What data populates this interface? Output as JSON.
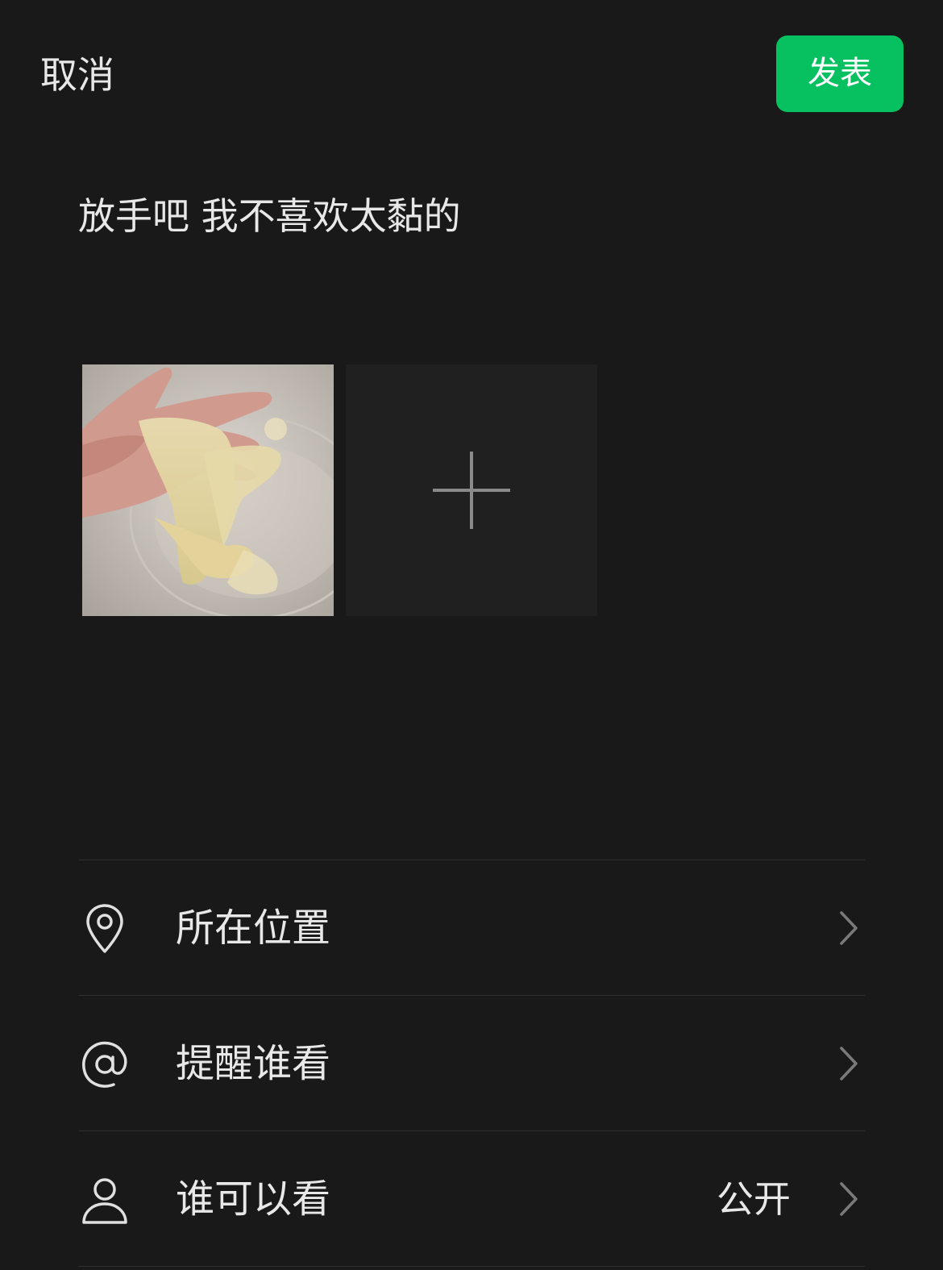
{
  "header": {
    "cancel_label": "取消",
    "publish_label": "发表"
  },
  "post": {
    "text": "放手吧 我不喜欢太黏的"
  },
  "media": {
    "add_icon": "plus-icon"
  },
  "options": [
    {
      "icon": "location-pin-icon",
      "label": "所在位置",
      "value": ""
    },
    {
      "icon": "at-sign-icon",
      "label": "提醒谁看",
      "value": ""
    },
    {
      "icon": "person-icon",
      "label": "谁可以看",
      "value": "公开"
    }
  ],
  "colors": {
    "background": "#191919",
    "accent": "#07c160",
    "text": "#e8e8e8",
    "divider": "#2f2f2f",
    "tile": "#202020"
  }
}
